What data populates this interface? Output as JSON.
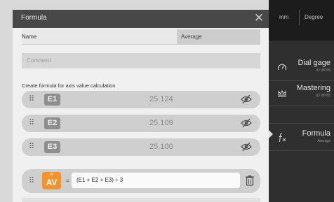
{
  "dialog": {
    "title": "Formula",
    "name_label": "Name",
    "name_value": "Average",
    "comment_placeholder": "Comment",
    "section_label": "Create formula for axis value calculation",
    "inputs": [
      {
        "id": "E1",
        "value": "25.124"
      },
      {
        "id": "E2",
        "value": "25.109"
      },
      {
        "id": "E3",
        "value": "25.100"
      }
    ],
    "result": {
      "badge_top": "∞",
      "badge": "AV",
      "equals": "=",
      "expression": "(E1 + E2 + E3) ÷ 3"
    }
  },
  "panel": {
    "units": [
      "mm",
      "Degree"
    ],
    "items": [
      {
        "title": "Dial gage",
        "sub": "ID 98765",
        "icon": "dial-gage-icon"
      },
      {
        "title": "Mastering",
        "sub": "ID 98765",
        "icon": "crown-icon"
      },
      {
        "title": "Formula",
        "sub": "Average",
        "icon": "formula-icon"
      }
    ]
  },
  "colors": {
    "accent": "#f2932f",
    "header": "#484848"
  }
}
